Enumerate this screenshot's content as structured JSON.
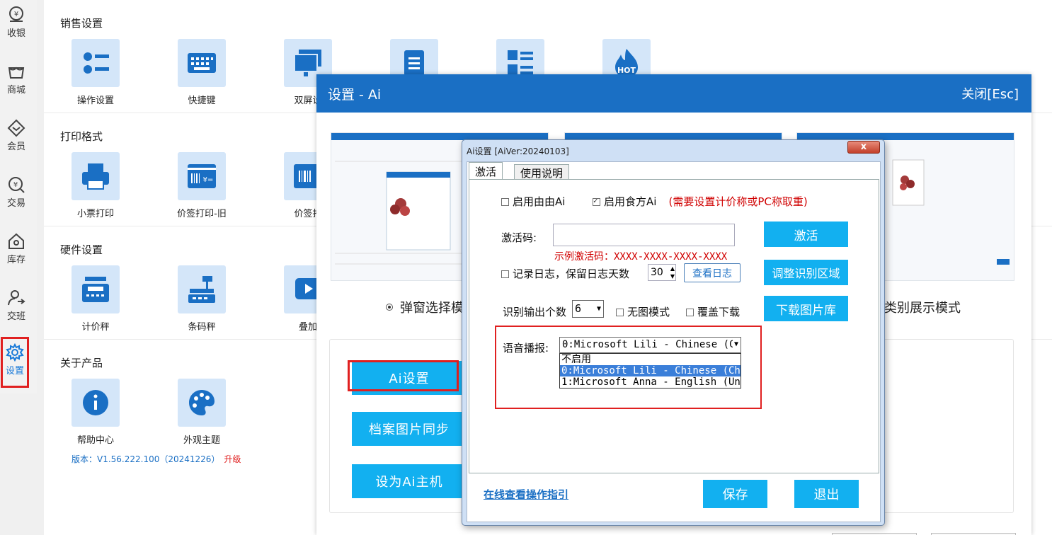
{
  "nav": {
    "items": [
      {
        "label": "收银"
      },
      {
        "label": "商城"
      },
      {
        "label": "会员"
      },
      {
        "label": "交易"
      },
      {
        "label": "库存"
      },
      {
        "label": "交班"
      },
      {
        "label": "设置"
      }
    ]
  },
  "sections": {
    "sales": {
      "title": "销售设置",
      "tiles": [
        "操作设置",
        "快捷键",
        "双屏设"
      ]
    },
    "print": {
      "title": "打印格式",
      "tiles": [
        "小票打印",
        "价签打印-旧",
        "价签打"
      ]
    },
    "hardware": {
      "title": "硬件设置",
      "tiles": [
        "计价秤",
        "条码秤",
        "叠加"
      ]
    },
    "about": {
      "title": "关于产品",
      "tiles": [
        "帮助中心",
        "外观主题"
      ]
    }
  },
  "version": {
    "text": "版本：V1.56.222.100（20241226）",
    "upgrade": "升级"
  },
  "hot_badge": "HOT",
  "panel": {
    "title": "设置 - Ai",
    "close": "关闭[Esc]",
    "mode_left": "弹窗选择模",
    "mode_right": "类别展示模式",
    "buttons": {
      "ai_settings": "Ai设置",
      "sync_images": "档案图片同步",
      "set_master": "设为Ai主机"
    }
  },
  "dialog": {
    "title": "Ai设置 [AiVer:20240103]",
    "close_x": "x",
    "tabs": {
      "activate": "激活",
      "manual": "使用说明"
    },
    "enable_youyou": "启用由由Ai",
    "enable_shifang": "启用食方Ai",
    "enable_note": "(需要设置计价称或PC称取重)",
    "activation_code_label": "激活码:",
    "activation_code_value": "",
    "activation_example": "示例激活码：XXXX-XXXX-XXXX-XXXX",
    "activate_button": "激活",
    "log_label": "记录日志，保留日志天数",
    "log_days": "30",
    "view_log": "查看日志",
    "adjust_area": "调整识别区域",
    "output_count_label": "识别输出个数",
    "output_count_value": "6",
    "no_image_mode": "无图模式",
    "overwrite_download": "覆盖下载",
    "download_library": "下载图片库",
    "voice_label": "语音播报:",
    "voice_selected": "0:Microsoft Lili - Chinese (C",
    "voice_options": [
      "不启用",
      "0:Microsoft Lili - Chinese (Chir",
      "1:Microsoft Anna - English (Unit"
    ],
    "online_guide": "在线查看操作指引",
    "save": "保存",
    "exit": "退出"
  }
}
